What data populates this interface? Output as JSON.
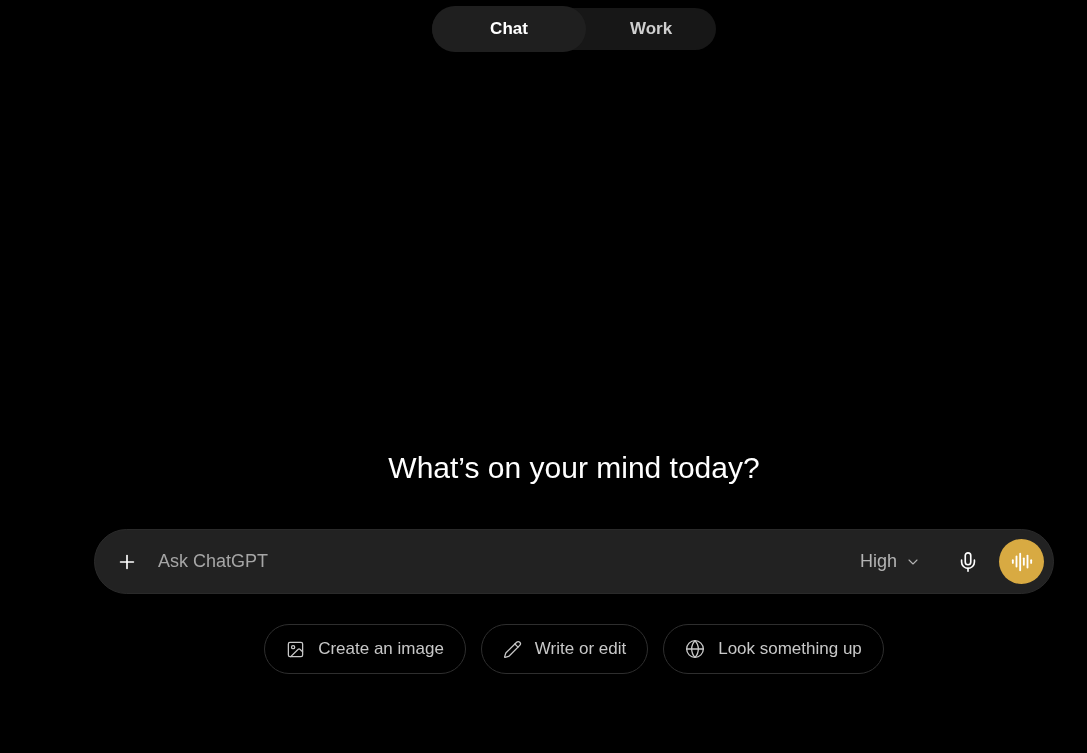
{
  "tabs": [
    {
      "label": "Chat",
      "selected": true
    },
    {
      "label": "Work",
      "selected": false
    }
  ],
  "heading": "What’s on your mind today?",
  "composer": {
    "placeholder": "Ask ChatGPT",
    "model_menu": "High"
  },
  "suggestions": [
    {
      "kind": "image",
      "label": "Create an image"
    },
    {
      "kind": "write",
      "label": "Write or edit"
    },
    {
      "kind": "search",
      "label": "Look something up"
    }
  ]
}
